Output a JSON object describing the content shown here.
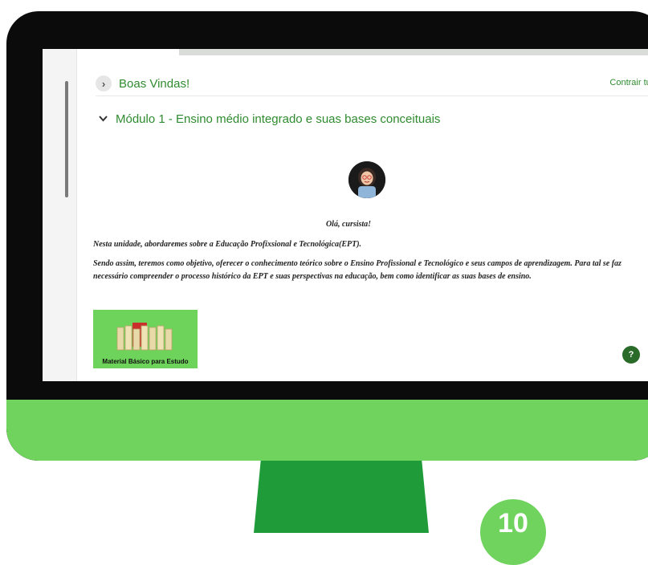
{
  "course": {
    "sections": [
      {
        "title": "Boas Vindas!",
        "state": "collapsed"
      },
      {
        "title": "Módulo 1 - Ensino médio integrado e suas bases conceituais",
        "state": "expanded"
      }
    ],
    "collapse_all_label": "Contrair tudo",
    "greeting": "Olá, cursista!",
    "paragraphs": [
      "Nesta unidade, abordaremes sobre a Educação Profixsional e Tecnológica(EPT).",
      "Sendo assim, teremos como objetivo, oferecer o conhecimento teórico sobre o Ensino Profissional e Tecnológico e seus campos de aprendizagem. Para tal se faz necessário compreender o processo histórico da EPT e suas perspectivas na educação, bem como identificar as suas bases de ensino."
    ],
    "material_label": "Material Básico para Estudo",
    "help_label": "?"
  },
  "badge_number": "10",
  "colors": {
    "accent_green": "#2f8b2f",
    "monitor_chin": "#6fd35e",
    "stand": "#1f9b3a"
  }
}
